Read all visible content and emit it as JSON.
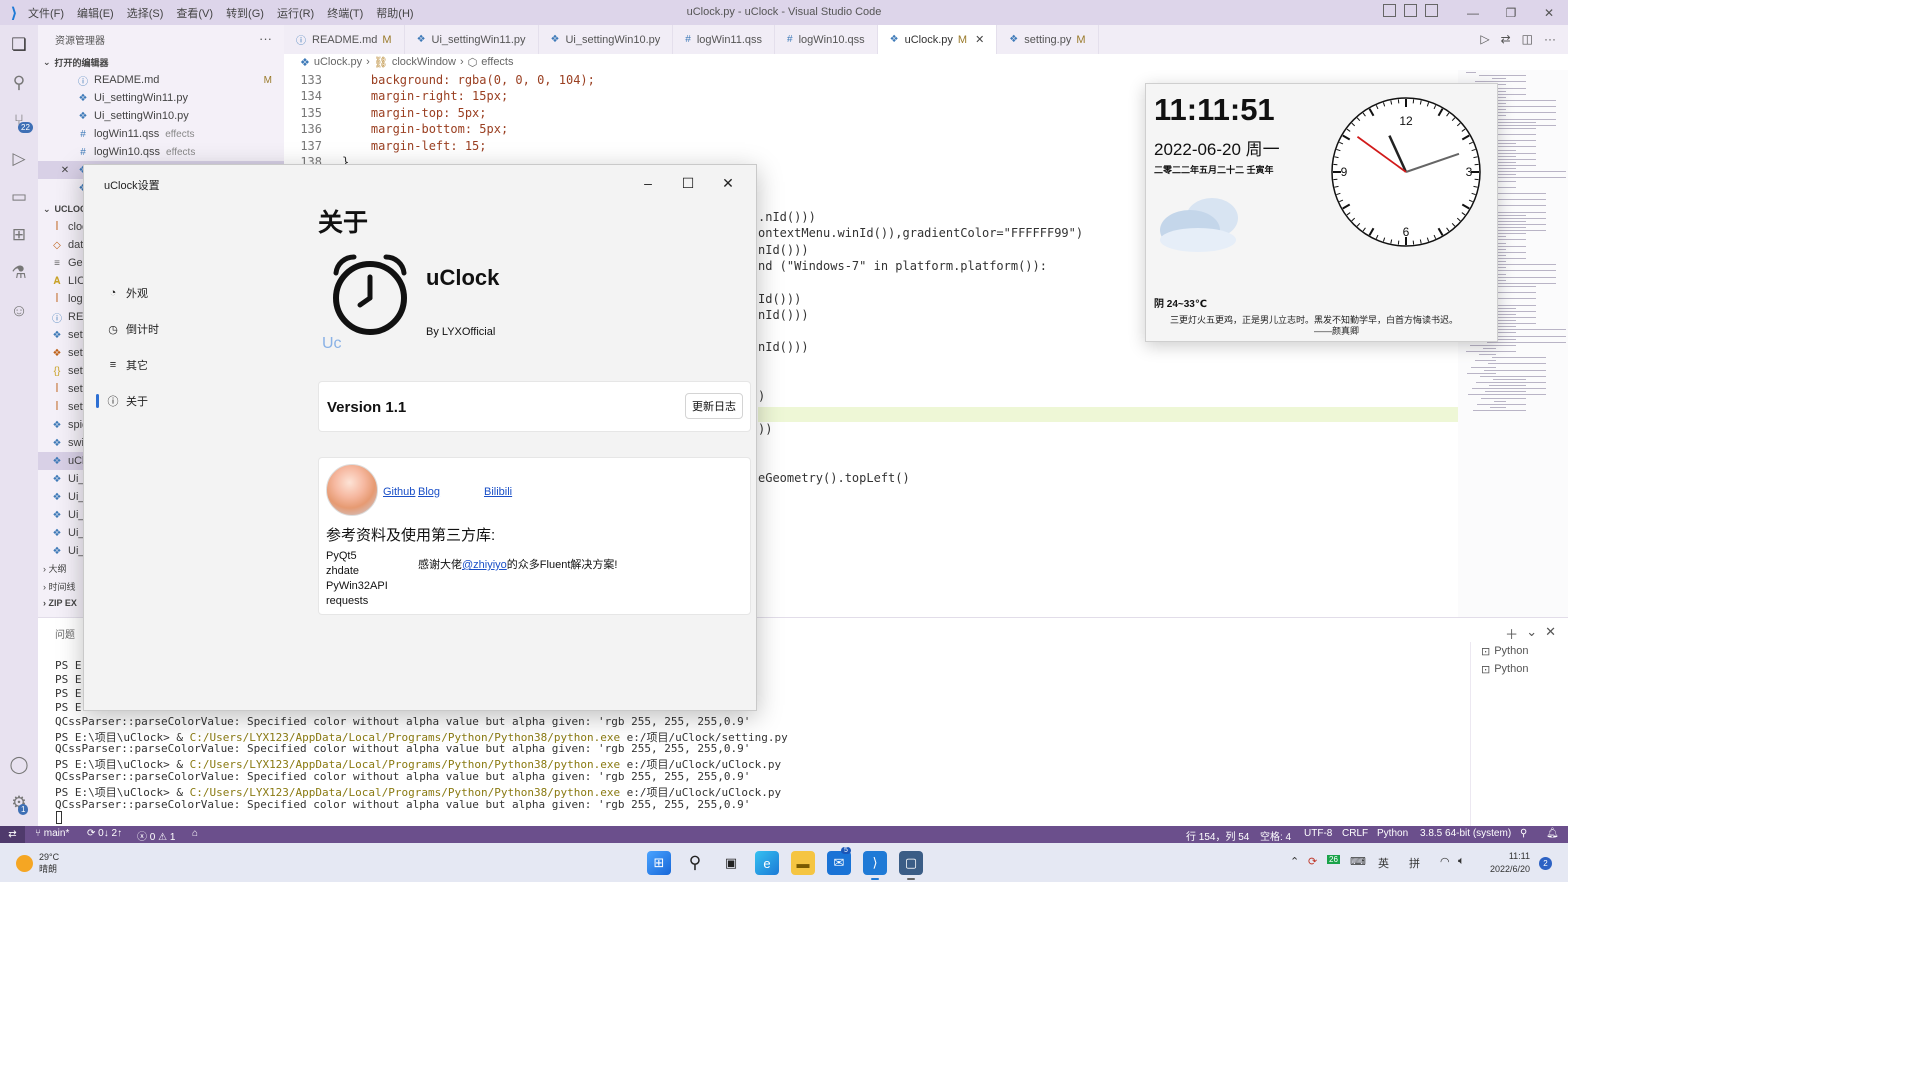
{
  "window": {
    "title": "uClock.py - uClock - Visual Studio Code",
    "menu": [
      "文件(F)",
      "编辑(E)",
      "选择(S)",
      "查看(V)",
      "转到(G)",
      "运行(R)",
      "终端(T)",
      "帮助(H)"
    ]
  },
  "activity": {
    "scm_badge": "22",
    "settings_badge": "1"
  },
  "explorer": {
    "header": "资源管理器",
    "open_editors": "打开的编辑器",
    "open_files": [
      {
        "name": "README.md",
        "flag": "M"
      },
      {
        "name": "Ui_settingWin11.py",
        "flag": ""
      },
      {
        "name": "Ui_settingWin10.py",
        "flag": ""
      },
      {
        "name": "logWin11.qss",
        "sub": "effects"
      },
      {
        "name": "logWin10.qss",
        "sub": "effects"
      }
    ],
    "project_section": "UCLOC",
    "project_files": [
      "cloc",
      "dat",
      "Geo",
      "LIC",
      "log",
      "REA",
      "sett",
      "sett",
      "sett",
      "sett",
      "sett",
      "spic",
      "swi",
      "uCl",
      "Ui_",
      "Ui_",
      "Ui_",
      "Ui_",
      "Ui_"
    ],
    "outline": "大纲",
    "timeline": "时间线",
    "zip": "ZIP EX"
  },
  "tabs": [
    {
      "label": "README.md",
      "icon": "ⓘ",
      "flag": "M"
    },
    {
      "label": "Ui_settingWin11.py",
      "icon": "❖",
      "flag": ""
    },
    {
      "label": "Ui_settingWin10.py",
      "icon": "❖",
      "flag": ""
    },
    {
      "label": "logWin11.qss",
      "icon": "#",
      "flag": ""
    },
    {
      "label": "logWin10.qss",
      "icon": "#",
      "flag": ""
    },
    {
      "label": "uClock.py",
      "icon": "❖",
      "flag": "M"
    },
    {
      "label": "setting.py",
      "icon": "❖",
      "flag": "M"
    }
  ],
  "breadcrumb": [
    "uClock.py",
    "clockWindow",
    "effects"
  ],
  "editor": {
    "lines": [
      {
        "n": "133",
        "code": "    background: rgba(0, 0, 0, 104);"
      },
      {
        "n": "134",
        "code": "    margin-right: 15px;"
      },
      {
        "n": "135",
        "code": "    margin-top: 5px;"
      },
      {
        "n": "136",
        "code": "    margin-bottom: 5px;"
      },
      {
        "n": "137",
        "code": "    margin-left: 15;"
      },
      {
        "n": "138",
        "code": "}"
      }
    ],
    "fragments": [
      ".nId()))",
      "ontextMenu.winId()),gradientColor=\"FFFFFF99\")",
      "nId()))",
      "nd (\"Windows-7\" in platform.platform()):",
      "",
      "Id()))",
      "nId()))",
      "",
      "nId()))",
      "",
      "",
      ")",
      "",
      "))",
      "",
      "",
      "eGeometry().topLeft()"
    ]
  },
  "panel": {
    "tab": "问题",
    "terminals": [
      "Python",
      "Python"
    ],
    "lines": [
      {
        "prefix": "PS E:",
        "path": "",
        "rest": ""
      },
      {
        "prefix": "PS E:",
        "path": "",
        "rest": ""
      },
      {
        "prefix": "PS E:",
        "path": "",
        "rest": ""
      },
      {
        "prefix": "PS E:",
        "path": "",
        "rest": ""
      },
      {
        "prefix": "QCssParser::parseColorValue: Specified color without alpha value but alpha given: 'rgb 255, 255, 255,0.9'",
        "path": "",
        "rest": ""
      },
      {
        "prefix": "PS E:\\项目\\uClock> & ",
        "path": "C:/Users/LYX123/AppData/Local/Programs/Python/Python38/python.exe",
        "rest": " e:/项目/uClock/setting.py"
      },
      {
        "prefix": "QCssParser::parseColorValue: Specified color without alpha value but alpha given: 'rgb 255, 255, 255,0.9'",
        "path": "",
        "rest": ""
      },
      {
        "prefix": "PS E:\\项目\\uClock> & ",
        "path": "C:/Users/LYX123/AppData/Local/Programs/Python/Python38/python.exe",
        "rest": " e:/项目/uClock/uClock.py"
      },
      {
        "prefix": "QCssParser::parseColorValue: Specified color without alpha value but alpha given: 'rgb 255, 255, 255,0.9'",
        "path": "",
        "rest": ""
      },
      {
        "prefix": "PS E:\\项目\\uClock> & ",
        "path": "C:/Users/LYX123/AppData/Local/Programs/Python/Python38/python.exe",
        "rest": " e:/项目/uClock/uClock.py"
      },
      {
        "prefix": "QCssParser::parseColorValue: Specified color without alpha value but alpha given: 'rgb 255, 255, 255,0.9'",
        "path": "",
        "rest": ""
      }
    ]
  },
  "statusbar": {
    "branch": "main*",
    "sync": "0↓ 2↑",
    "errors": "0",
    "warnings": "1",
    "position": "行 154，列 54",
    "spaces": "空格: 4",
    "encoding": "UTF-8",
    "eol": "CRLF",
    "language": "Python",
    "interpreter": "3.8.5 64-bit (system)"
  },
  "taskbar": {
    "temp": "29°C",
    "weather": "晴朗",
    "mail_badge": "5",
    "tray_num": "26",
    "ime1": "英",
    "ime2": "拼",
    "time": "11:11",
    "date": "2022/6/20",
    "notifications": "2"
  },
  "dialog": {
    "title": "uClock设置",
    "nav": [
      {
        "label": "外观",
        "icon": "◔"
      },
      {
        "label": "倒计时",
        "icon": "◷"
      },
      {
        "label": "其它",
        "icon": "≡"
      },
      {
        "label": "关于",
        "icon": "ⓘ"
      }
    ],
    "heading": "关于",
    "app_name": "uClock",
    "author": "By LYXOfficial",
    "logo_text": "Uc",
    "version": "Version 1.1",
    "changelog_button": "更新日志",
    "links": [
      "Github",
      "Blog",
      "Bilibili"
    ],
    "references_heading": "参考资料及使用第三方库:",
    "libraries": [
      "PyQt5",
      "zhdate",
      "PyWin32API",
      "requests"
    ],
    "thanks_prefix": "感谢大佬",
    "thanks_link": "@zhiyiyo",
    "thanks_suffix": "的众多Fluent解决方案!"
  },
  "widget": {
    "time": "11:11:51",
    "date": "2022-06-20 周一",
    "lunar": "二零二二年五月二十二 壬寅年",
    "weather": "阴 24~33℃",
    "quote": "三更灯火五更鸡，正是男儿立志时。黑发不知勤学早，白首方悔读书迟。",
    "quote_author": "——颜真卿",
    "dial_labels": [
      "12",
      "3",
      "6",
      "9"
    ],
    "clock_hands": {
      "hour": 11,
      "minute": 11,
      "second": 51
    }
  },
  "colors": {
    "accent": "#2d6fd3",
    "statusbar": "#6b4f8c",
    "second_hand": "#d11a1a"
  }
}
